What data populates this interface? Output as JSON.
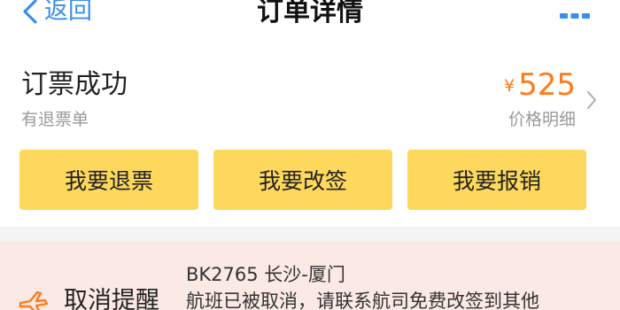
{
  "navbar": {
    "back_label": "返回",
    "title": "订单详情"
  },
  "order": {
    "status": "订票成功",
    "sub_status": "有退票单",
    "price": {
      "currency": "¥",
      "amount": "525",
      "detail_label": "价格明细"
    },
    "actions": [
      {
        "label": "我要退票"
      },
      {
        "label": "我要改签"
      },
      {
        "label": "我要报销"
      }
    ]
  },
  "notice": {
    "label": "取消提醒",
    "flight": "BK2765 长沙-厦门",
    "message": "航班已被取消，请联系航司免费改签到其他"
  },
  "colors": {
    "accent_blue": "#3b8ef0",
    "price_orange": "#ff7a1a",
    "button_yellow": "#fdd85c",
    "notice_background": "#fbe9e5"
  }
}
